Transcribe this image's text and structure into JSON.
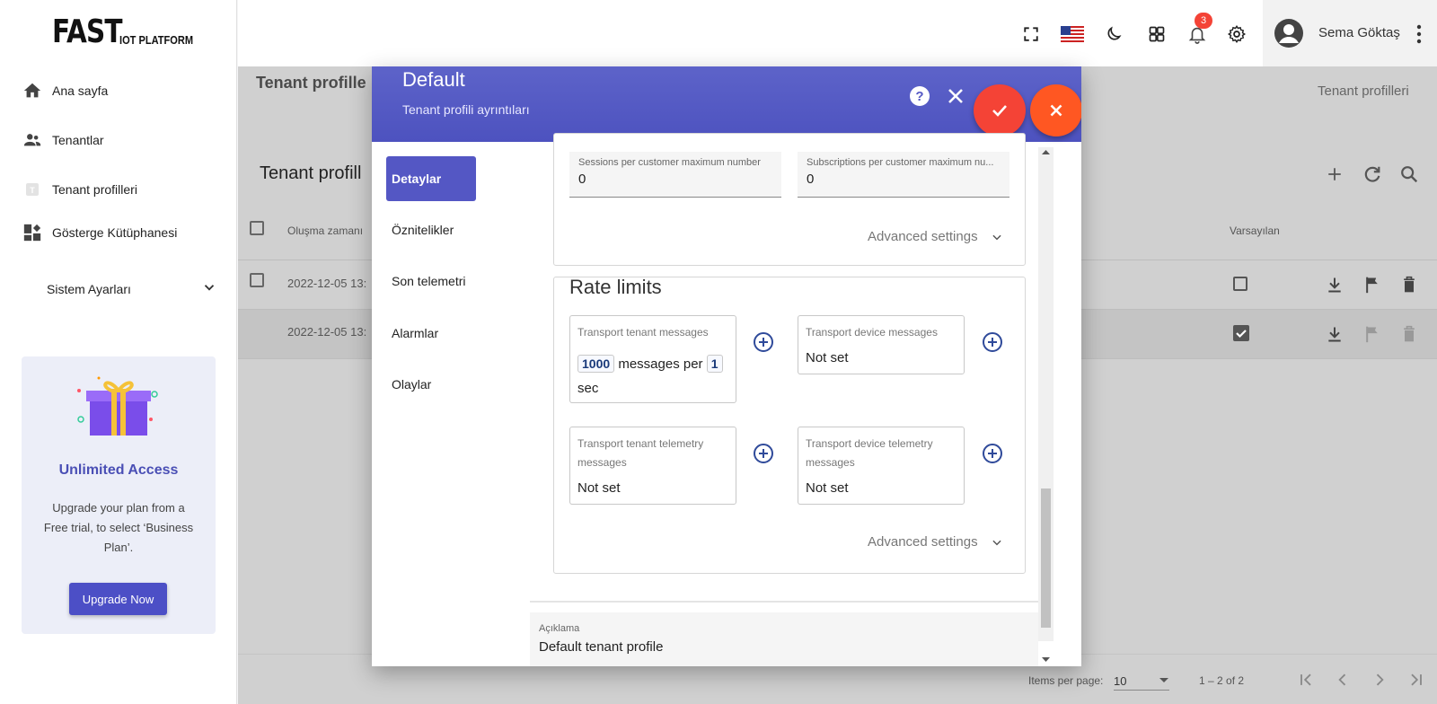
{
  "logo": {
    "big": "FAST",
    "small": "IOT PLATFORM"
  },
  "sidebar": {
    "items": [
      {
        "label": "Ana sayfa",
        "icon": "home-icon"
      },
      {
        "label": "Tenantlar",
        "icon": "people-icon"
      },
      {
        "label": "Tenant profilleri",
        "icon": "tenant-profile-icon"
      },
      {
        "label": "Gösterge Kütüphanesi",
        "icon": "dashboard-icon"
      }
    ],
    "settings_label": "Sistem Ayarları"
  },
  "promo": {
    "title": "Unlimited Access",
    "text": "Upgrade your plan from a Free trial, to select ‘Business Plan’.",
    "button": "Upgrade Now"
  },
  "topbar": {
    "notification_count": "3",
    "user_name": "Sema Göktaş"
  },
  "background": {
    "page_title": "Tenant profille",
    "breadcrumb": "Tenant profilleri",
    "card_title": "Tenant profill",
    "columns": {
      "created": "Oluşma zamanı",
      "default": "Varsayılan"
    },
    "rows": [
      {
        "created": "2022-12-05 13:",
        "default": false
      },
      {
        "created": "2022-12-05 13:",
        "default": true
      }
    ],
    "paginator": {
      "items_per_page_label": "Items per page:",
      "items_per_page": "10",
      "range": "1 – 2 of 2"
    }
  },
  "dialog": {
    "title": "Default",
    "subtitle": "Tenant profili ayrıntıları",
    "tabs": [
      "Detaylar",
      "Öznitelikler",
      "Son telemetri",
      "Alarmlar",
      "Olaylar"
    ],
    "fields_top": [
      {
        "label": "Sessions per customer maximum number",
        "value": "0"
      },
      {
        "label": "Subscriptions per customer maximum nu...",
        "value": "0"
      }
    ],
    "advanced_label": "Advanced settings",
    "rate_limits": {
      "title": "Rate limits",
      "tenant_messages": {
        "label": "Transport tenant messages",
        "count": "1000",
        "middle": "messages per",
        "period": "1",
        "unit": "sec"
      },
      "device_messages": {
        "label": "Transport device messages",
        "value": "Not set"
      },
      "tenant_telemetry": {
        "label": "Transport tenant telemetry messages",
        "value": "Not set"
      },
      "device_telemetry": {
        "label": "Transport device telemetry messages",
        "value": "Not set"
      }
    },
    "description": {
      "label": "Açıklama",
      "value": "Default tenant profile"
    }
  },
  "colors": {
    "primary": "#5457c4",
    "accent": "#f44336",
    "promo_title": "#4a4fb5"
  }
}
